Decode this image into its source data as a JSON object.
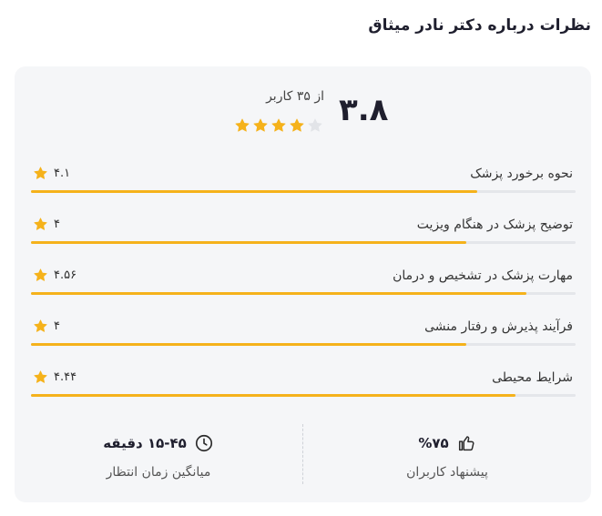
{
  "page": {
    "title": "نظرات درباره دکتر نادر میثاق"
  },
  "summary": {
    "score": "۳.۸",
    "count_text": "از ۳۵ کاربر",
    "stars_filled": 4,
    "stars_total": 5,
    "star_color": "#f5b21b",
    "star_empty_color": "#e2e4e8"
  },
  "criteria": [
    {
      "label": "نحوه برخورد پزشک",
      "value": "۴.۱",
      "fill": 0.82
    },
    {
      "label": "توضیح پزشک در هنگام ویزیت",
      "value": "۴",
      "fill": 0.8
    },
    {
      "label": "مهارت پزشک در تشخیص و درمان",
      "value": "۴.۵۶",
      "fill": 0.91
    },
    {
      "label": "فرآیند پذیرش و رفتار منشی",
      "value": "۴",
      "fill": 0.8
    },
    {
      "label": "شرایط محیطی",
      "value": "۴.۴۴",
      "fill": 0.89
    }
  ],
  "stats": {
    "recommend": {
      "value": "%۷۵",
      "label": "پیشنهاد کاربران",
      "icon": "thumbs-up-icon"
    },
    "wait": {
      "value": "۱۵-۴۵ دقیقه",
      "label": "میانگین زمان انتظار",
      "icon": "clock-icon"
    }
  }
}
